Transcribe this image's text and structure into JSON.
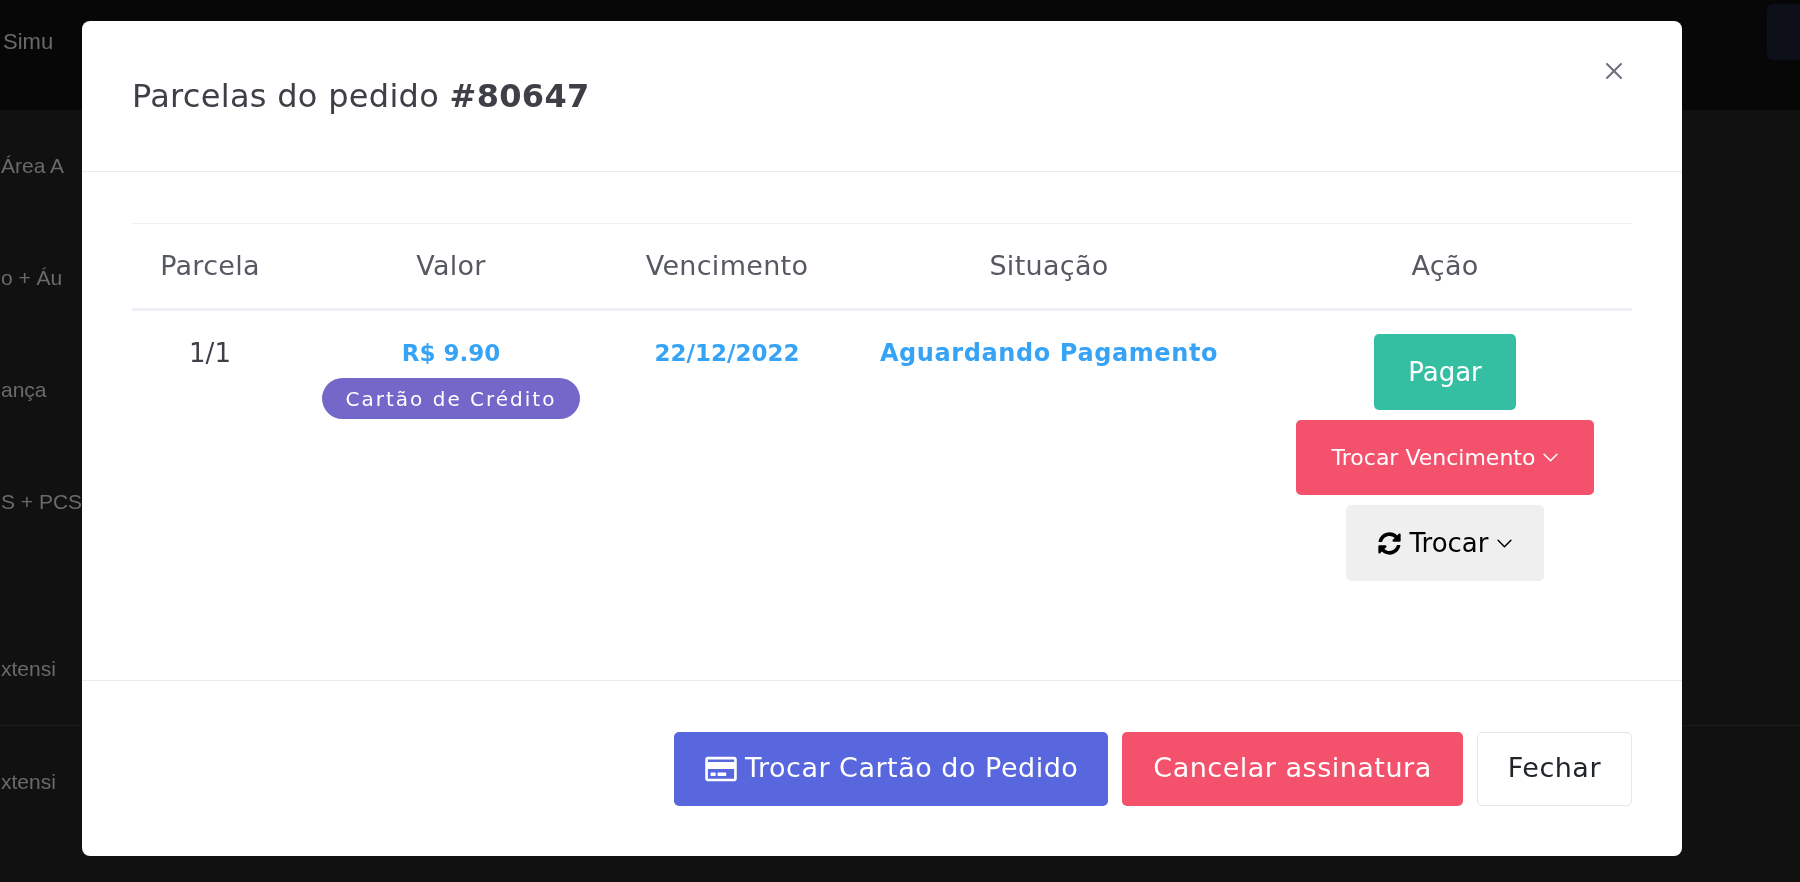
{
  "background": {
    "header_text": "Simu",
    "sections": [
      {
        "items": [
          "Área A",
          "o + Áu",
          "ança",
          "S + PCS"
        ]
      },
      {
        "items": [
          "xtensi",
          "xtensi"
        ]
      }
    ]
  },
  "modal": {
    "title": "Parcelas do pedido **#80647**",
    "table": {
      "columns": [
        "Parcela",
        "Valor",
        "Vencimento",
        "Situação",
        "Ação"
      ],
      "rows": [
        {
          "installment": "1/1",
          "amount": "R$ 9.90",
          "payment_method": "Cartão de Crédito",
          "due_date": "22/12/2022",
          "status": "Aguardando Pagamento",
          "actions": [
            {
              "kind": "pay",
              "label": "Pagar"
            },
            {
              "kind": "dropdown",
              "label": "Trocar Vencimento"
            },
            {
              "kind": "refresh-dropdown",
              "label": "Trocar"
            }
          ]
        }
      ]
    },
    "footer_buttons": [
      {
        "kind": "card",
        "label": "Trocar Cartão do Pedido"
      },
      {
        "kind": "danger",
        "label": "Cancelar assinatura"
      },
      {
        "kind": "plain",
        "label": "Fechar"
      }
    ]
  }
}
